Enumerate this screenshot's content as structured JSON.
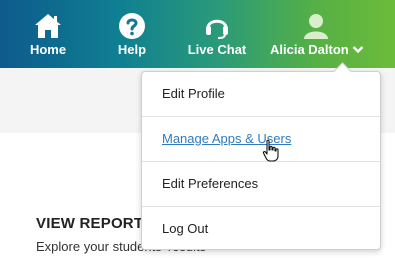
{
  "nav": {
    "home_label": "Home",
    "help_label": "Help",
    "chat_label": "Live Chat",
    "user_label": "Alicia Dalton",
    "icons": {
      "home": "home-icon",
      "help": "question-circle-icon",
      "chat": "headset-icon",
      "user": "user-icon",
      "chevron": "chevron-down-icon"
    }
  },
  "menu": {
    "items": [
      {
        "label": "Edit Profile"
      },
      {
        "label": "Manage Apps & Users"
      },
      {
        "label": "Edit Preferences"
      },
      {
        "label": "Log Out"
      }
    ]
  },
  "content": {
    "view_reports_title": "VIEW REPORT",
    "view_reports_subtitle": "Explore your students' results"
  },
  "colors": {
    "gradient_start": "#0e5a8c",
    "gradient_end": "#6cbb3a",
    "link": "#2f7bbf"
  }
}
